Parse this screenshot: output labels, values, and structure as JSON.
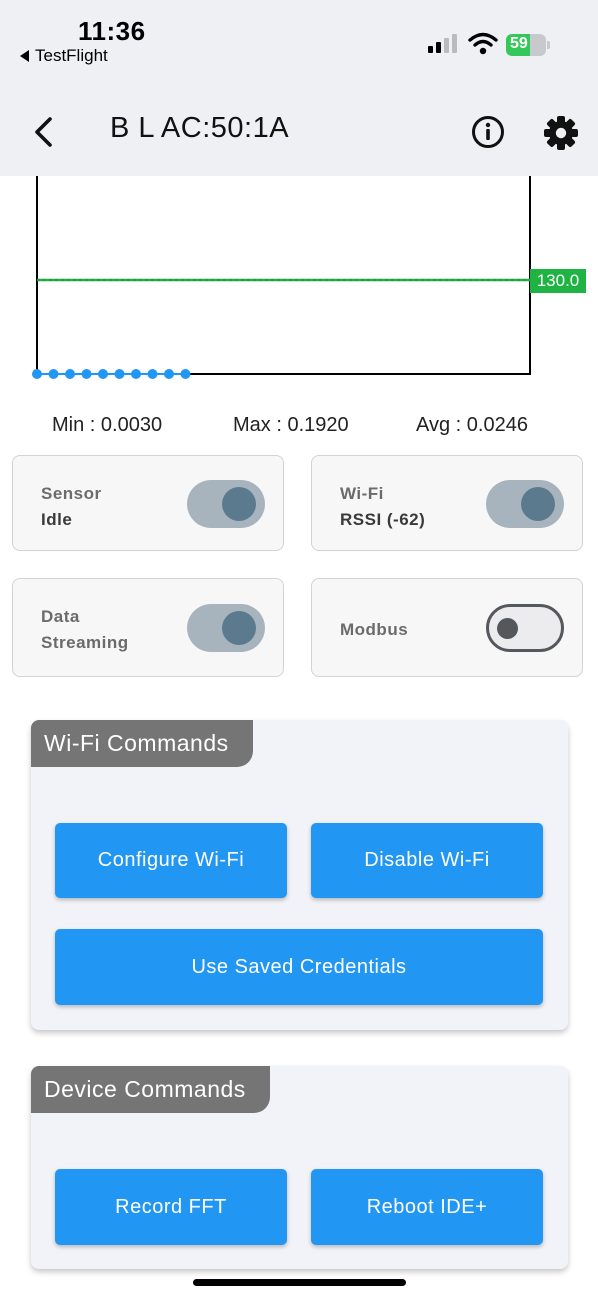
{
  "status_bar": {
    "time": "11:36",
    "back_app": "TestFlight",
    "battery": "59"
  },
  "header": {
    "title": "B L AC:50:1A",
    "back_icon": "chevron-left-icon",
    "info_icon": "info-icon",
    "settings_icon": "gear-icon"
  },
  "chart": {
    "reference_label": "130.0",
    "colors": {
      "reference_line": "#1fb344",
      "points": "#2196f3",
      "frame": "#000000"
    }
  },
  "chart_data": {
    "type": "line",
    "series": [
      {
        "values": [
          0,
          0,
          0,
          0,
          0,
          0,
          0,
          0,
          0,
          0
        ]
      }
    ],
    "reference_value": 130.0,
    "reference_label": "130.0"
  },
  "stats": {
    "min": "Min : 0.0030",
    "max": "Max : 0.1920",
    "avg": "Avg : 0.0246"
  },
  "tiles": {
    "sensor": {
      "label": "Sensor",
      "value": "Idle",
      "on": true
    },
    "wifi": {
      "label": "Wi-Fi",
      "value": "RSSI (-62)",
      "on": true
    },
    "data_streaming": {
      "label_line1": "Data",
      "label_line2": "Streaming",
      "on": true
    },
    "modbus": {
      "label": "Modbus",
      "on": false
    }
  },
  "wifi_commands": {
    "title": "Wi-Fi Commands",
    "configure": "Configure Wi-Fi",
    "disable": "Disable Wi-Fi",
    "use_saved": "Use Saved Credentials"
  },
  "device_commands": {
    "title": "Device Commands",
    "record_fft": "Record FFT",
    "reboot": "Reboot IDE+"
  },
  "colors": {
    "accent": "#2196f3",
    "header_tag": "#757575",
    "toggle_on_track": "#a7b4be",
    "toggle_on_knob": "#5c7a8e"
  }
}
